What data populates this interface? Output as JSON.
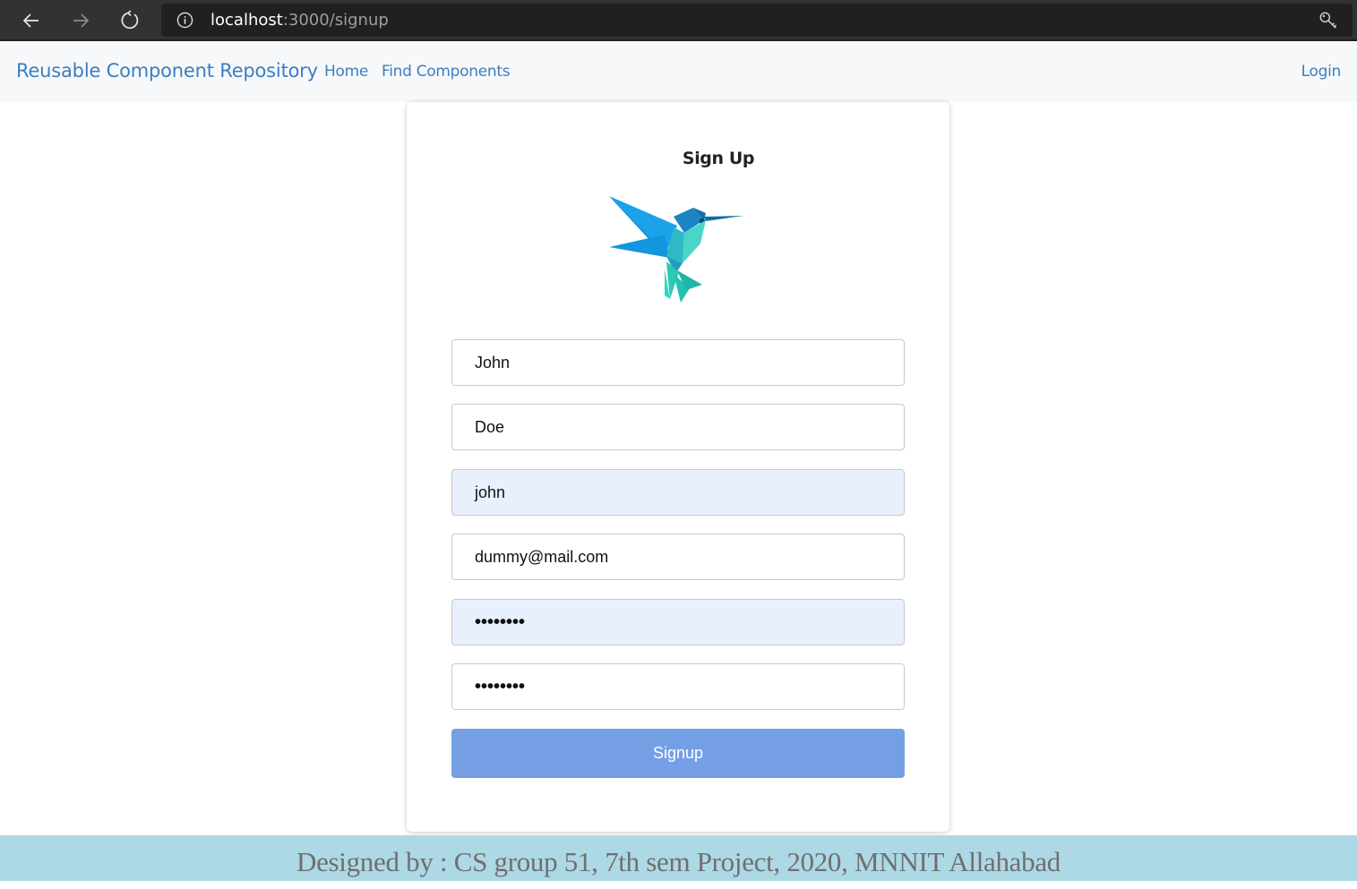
{
  "browser": {
    "url_host": "localhost",
    "url_path": ":3000/signup",
    "icons": {
      "back": "arrow-left-icon",
      "forward": "arrow-right-icon",
      "reload": "reload-icon",
      "info": "info-icon",
      "key": "key-icon"
    }
  },
  "navbar": {
    "brand": "Reusable Component Repository",
    "links": [
      "Home",
      "Find Components"
    ],
    "login": "Login"
  },
  "form": {
    "title": "Sign Up",
    "logo": "hummingbird-logo",
    "fields": [
      {
        "name": "first-name",
        "value": "John",
        "autofilled": false
      },
      {
        "name": "last-name",
        "value": "Doe",
        "autofilled": false
      },
      {
        "name": "username",
        "value": "john",
        "autofilled": true
      },
      {
        "name": "email",
        "value": "dummy@mail.com",
        "autofilled": false
      },
      {
        "name": "password",
        "value": "••••••••",
        "autofilled": true
      },
      {
        "name": "confirm-password",
        "value": "••••••••",
        "autofilled": false
      }
    ],
    "submit_label": "Signup"
  },
  "footer": {
    "text": "Designed by : CS group 51, 7th sem Project, 2020, MNNIT Allahabad"
  },
  "colors": {
    "brand": "#3b7ec3",
    "button": "#749fe5",
    "footer_bg": "#add8e6",
    "autofill_bg": "#e8f0fe"
  }
}
